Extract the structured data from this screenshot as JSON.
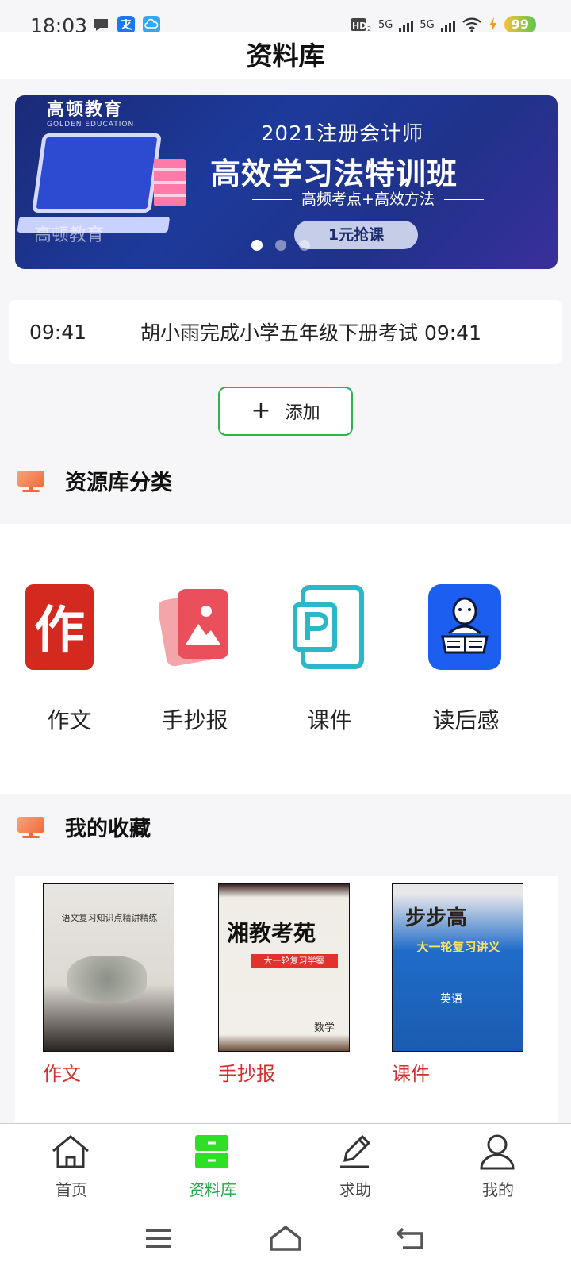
{
  "status_bar": {
    "time": "18:03",
    "network_labels": [
      "5G",
      "5G"
    ],
    "battery": "99",
    "icons": [
      "chat-bubble-icon",
      "alipay-icon",
      "cloud-icon",
      "hd-icon",
      "signal-icon",
      "wifi-icon",
      "charging-icon"
    ]
  },
  "header": {
    "title": "资料库"
  },
  "banner": {
    "brand": "高顿教育",
    "brand_en": "GOLDEN EDUCATION",
    "year_line": "2021注册会计师",
    "headline": "高效学习法特训班",
    "subline": "高频考点+高效方法",
    "cta": "1元抢课",
    "watermark": "高顿教育",
    "dots": 3,
    "active_dot": 0
  },
  "notice": {
    "time": "09:41",
    "text": "胡小雨完成小学五年级下册考试 09:41"
  },
  "add_button": {
    "icon": "plus-icon",
    "label": "添加"
  },
  "categories_section": {
    "title": "资源库分类",
    "items": [
      {
        "label": "作文",
        "icon": "zuowen-icon",
        "color": "#d3291f"
      },
      {
        "label": "手抄报",
        "icon": "picture-card-icon",
        "color": "#e9505b"
      },
      {
        "label": "课件",
        "icon": "ppt-file-icon",
        "color": "#2ab8c8"
      },
      {
        "label": "读后感",
        "icon": "reading-person-icon",
        "color": "#1b5ef0"
      }
    ]
  },
  "favorites_section": {
    "title": "我的收藏",
    "items": [
      {
        "label": "作文",
        "cover_title": "语文复习知识点精讲精练"
      },
      {
        "label": "手抄报",
        "cover_title": "湘教考苑",
        "cover_sub": "大一轮复习学案",
        "cover_subject": "数学"
      },
      {
        "label": "课件",
        "cover_title": "步步高",
        "cover_sub": "大一轮复习讲义",
        "cover_subject": "英语"
      }
    ]
  },
  "tabbar": {
    "items": [
      {
        "label": "首页",
        "icon": "home-icon",
        "active": false
      },
      {
        "label": "资料库",
        "icon": "library-icon",
        "active": true
      },
      {
        "label": "求助",
        "icon": "pencil-icon",
        "active": false
      },
      {
        "label": "我的",
        "icon": "user-icon",
        "active": false
      }
    ],
    "active_color": "#24a845"
  },
  "system_nav": {
    "items": [
      "menu-icon",
      "home-outline-icon",
      "back-icon"
    ]
  }
}
